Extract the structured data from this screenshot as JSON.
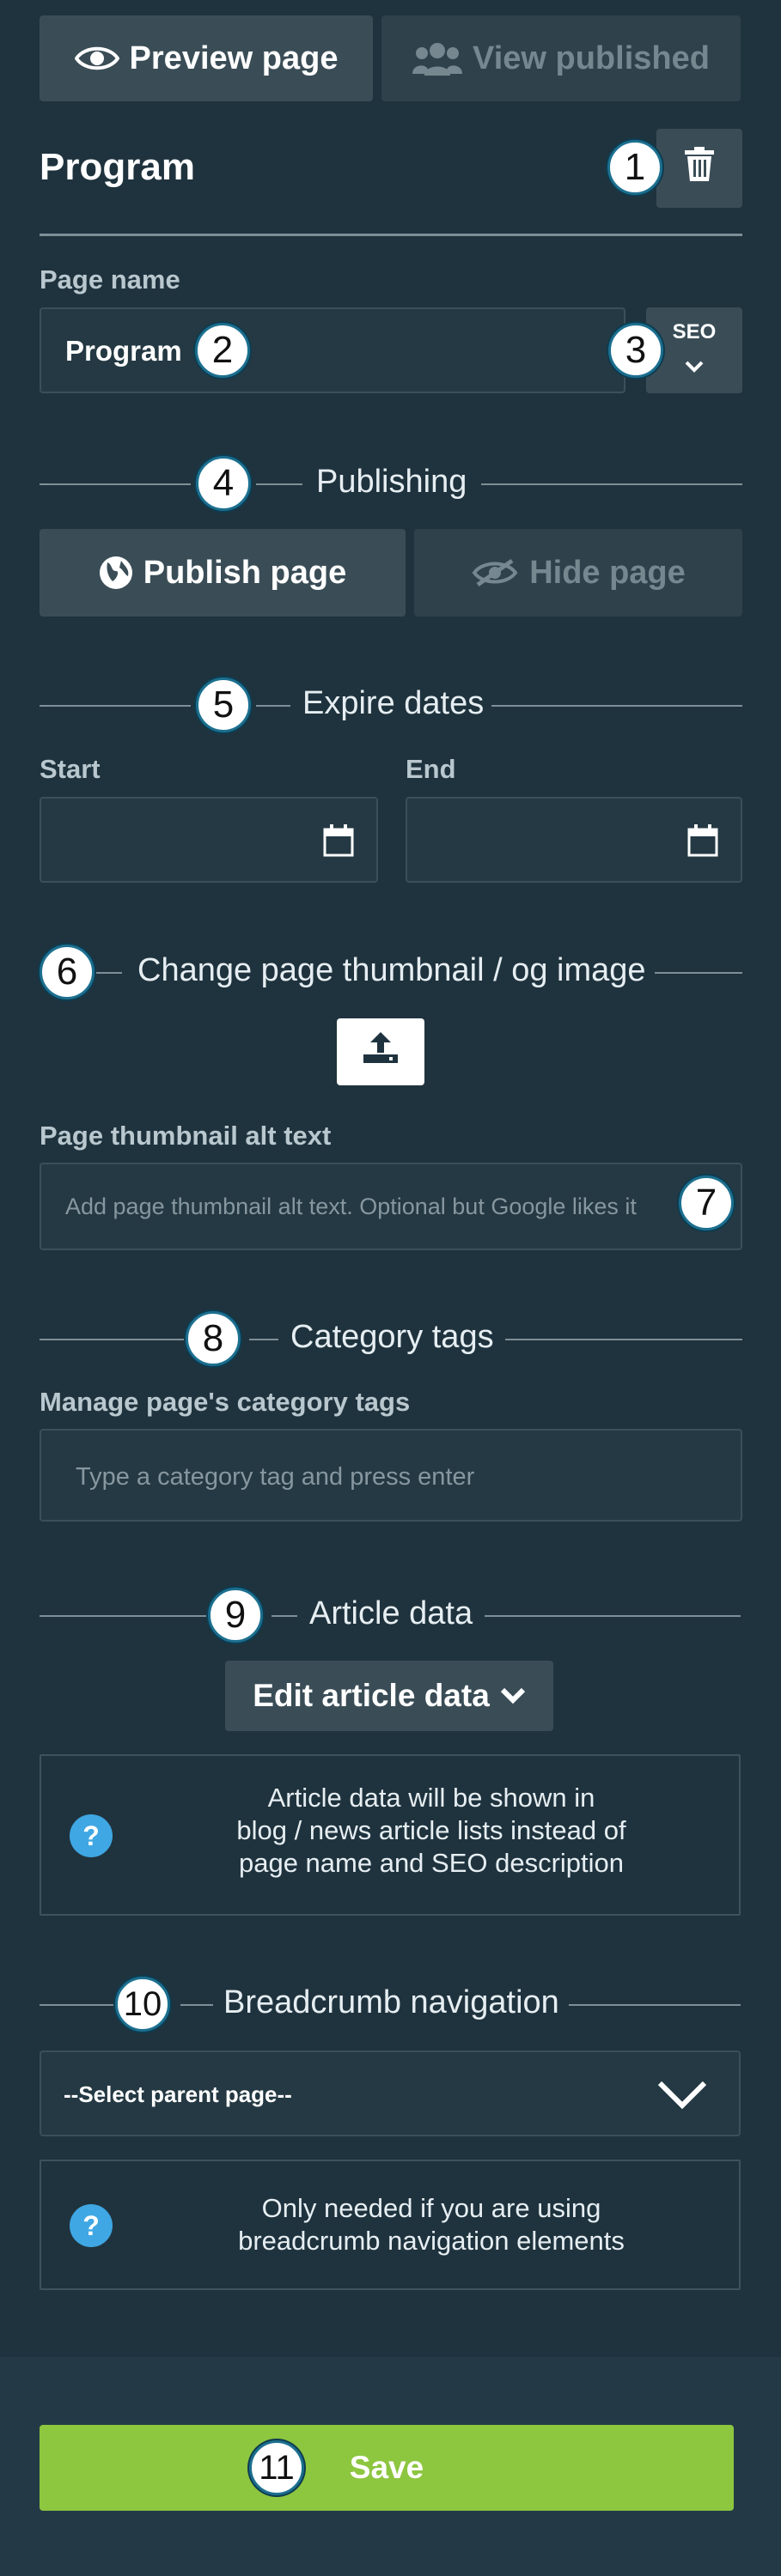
{
  "top": {
    "preview_label": "Preview page",
    "view_published_label": "View published"
  },
  "header": {
    "title": "Program"
  },
  "page_name": {
    "label": "Page name",
    "value": "Program",
    "seo_label": "SEO"
  },
  "publishing": {
    "title": "Publishing",
    "publish_label": "Publish page",
    "hide_label": "Hide page"
  },
  "expire": {
    "title": "Expire dates",
    "start_label": "Start",
    "end_label": "End"
  },
  "thumbnail": {
    "title": "Change page thumbnail / og image",
    "alt_label": "Page thumbnail alt text",
    "alt_placeholder": "Add page thumbnail alt text. Optional but Google likes it"
  },
  "tags": {
    "title": "Category tags",
    "label": "Manage page's category tags",
    "placeholder": "Type a category tag and press enter"
  },
  "article": {
    "title": "Article data",
    "edit_label": "Edit article data",
    "info_line1": "Article data will be shown in",
    "info_line2": "blog / news article lists instead of",
    "info_line3": "page name and SEO description"
  },
  "breadcrumb": {
    "title": "Breadcrumb navigation",
    "select_value": "--Select parent page--",
    "info_line1": "Only needed if you are using",
    "info_line2": "breadcrumb navigation elements"
  },
  "footer": {
    "save_label": "Save"
  },
  "badges": [
    "1",
    "2",
    "3",
    "4",
    "5",
    "6",
    "7",
    "8",
    "9",
    "10",
    "11"
  ],
  "colors": {
    "background": "#1f333e",
    "button": "#3a4d57",
    "save": "#8dc63f",
    "info_icon": "#3fa7e3"
  }
}
